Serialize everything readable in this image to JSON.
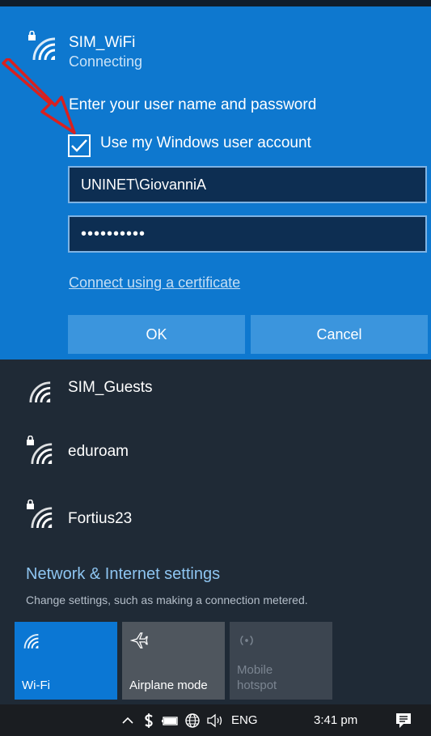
{
  "active_network": {
    "ssid": "SIM_WiFi",
    "status": "Connecting",
    "prompt": "Enter your user name and password",
    "use_windows_account_label": "Use my Windows user account",
    "use_windows_account_checked": true,
    "username_value": "UNINET\\GiovanniA",
    "password_mask": "••••••••••",
    "certificate_link": "Connect using a certificate",
    "ok_label": "OK",
    "cancel_label": "Cancel"
  },
  "networks": [
    {
      "name": "SIM_Guests",
      "secured": false
    },
    {
      "name": "eduroam",
      "secured": true
    },
    {
      "name": "Fortius23",
      "secured": true
    }
  ],
  "settings": {
    "title": "Network & Internet settings",
    "subtitle": "Change settings, such as making a connection metered."
  },
  "quick_actions": {
    "wifi_label": "Wi-Fi",
    "airplane_label": "Airplane mode",
    "hotspot_label_line1": "Mobile",
    "hotspot_label_line2": "hotspot"
  },
  "taskbar": {
    "language": "ENG",
    "time": "3:41 pm"
  },
  "colors": {
    "accent": "#0e78cf",
    "background": "#1f2a36",
    "link": "#8ec5f1",
    "annotation_arrow": "#d9201f"
  },
  "icons": [
    "wifi-icon",
    "lock-icon",
    "checkmark-icon",
    "airplane-icon",
    "hotspot-icon",
    "chevron-up-icon",
    "dollar-icon",
    "battery-icon",
    "globe-icon",
    "speaker-icon",
    "notification-icon"
  ]
}
